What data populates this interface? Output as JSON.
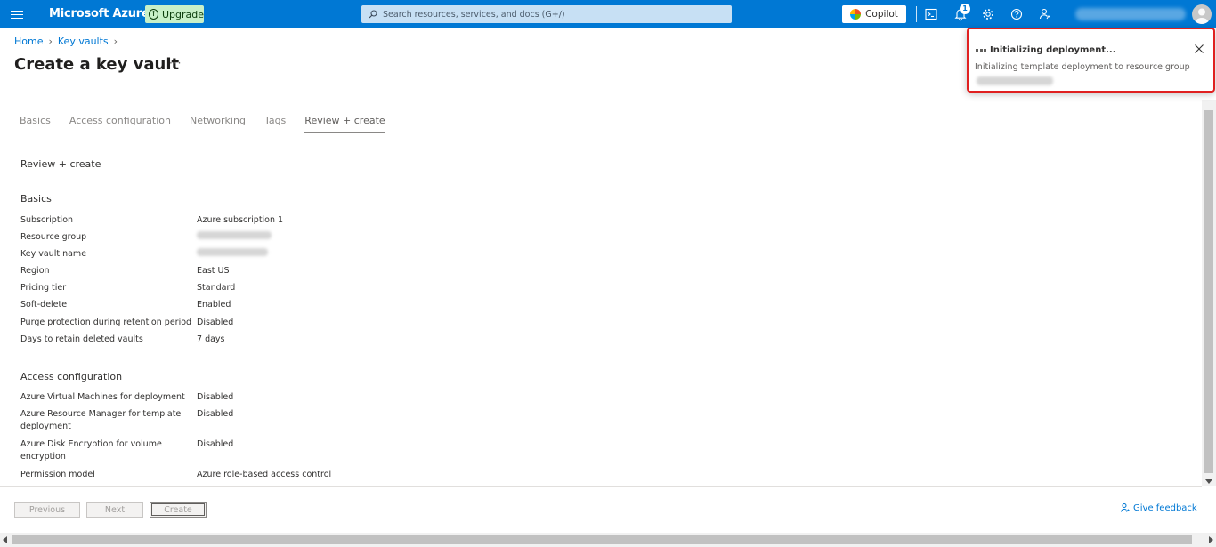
{
  "topbar": {
    "brand": "Microsoft Azure",
    "upgrade_label": "Upgrade",
    "search_placeholder": "Search resources, services, and docs (G+/)",
    "copilot_label": "Copilot",
    "notification_count": "1",
    "accent_color": "#0078d4"
  },
  "breadcrumb": {
    "items": [
      "Home",
      "Key vaults"
    ]
  },
  "page": {
    "title": "Create a key vault",
    "more": "···"
  },
  "tabs": [
    "Basics",
    "Access configuration",
    "Networking",
    "Tags",
    "Review + create"
  ],
  "active_tab": "Review + create",
  "review": {
    "heading": "Review + create",
    "basics_title": "Basics",
    "basics": [
      {
        "key": "Subscription",
        "value": "Azure subscription 1"
      },
      {
        "key": "Resource group",
        "value": ""
      },
      {
        "key": "Key vault name",
        "value": ""
      },
      {
        "key": "Region",
        "value": "East US"
      },
      {
        "key": "Pricing tier",
        "value": "Standard"
      },
      {
        "key": "Soft-delete",
        "value": "Enabled"
      },
      {
        "key": "Purge protection during retention period",
        "value": "Disabled"
      },
      {
        "key": "Days to retain deleted vaults",
        "value": "7 days"
      }
    ],
    "access_title": "Access configuration",
    "access": [
      {
        "key": "Azure Virtual Machines for deployment",
        "value": "Disabled"
      },
      {
        "key": "Azure Resource Manager for template deployment",
        "value": "Disabled"
      },
      {
        "key": "Azure Disk Encryption for volume encryption",
        "value": "Disabled"
      },
      {
        "key": "Permission model",
        "value": "Azure role-based access control"
      }
    ]
  },
  "footer": {
    "previous": "Previous",
    "next": "Next",
    "create": "Create",
    "feedback": "Give feedback"
  },
  "toast": {
    "title": "Initializing deployment...",
    "body": "Initializing template deployment to resource group",
    "highlight_color": "#e02020"
  }
}
